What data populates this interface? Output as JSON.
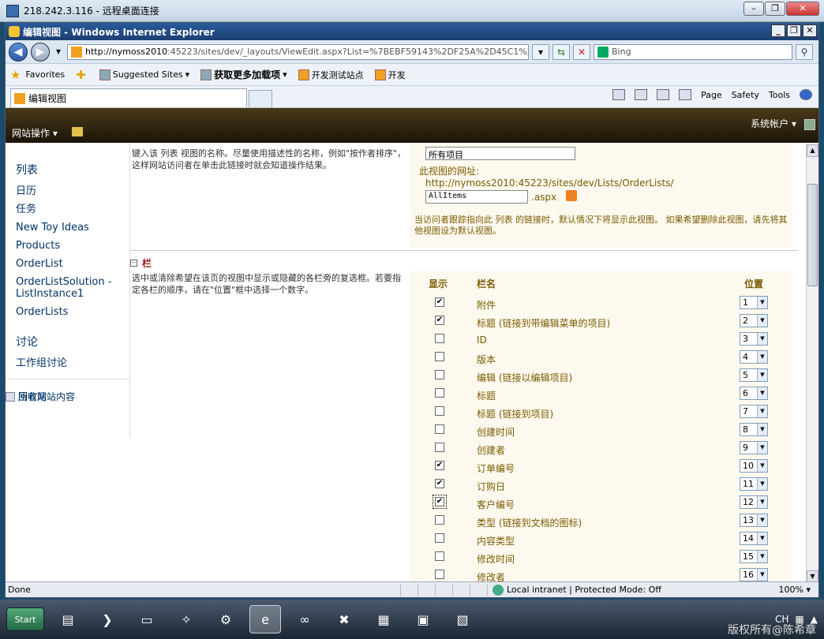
{
  "rdp": {
    "title": "218.242.3.116 - 远程桌面连接"
  },
  "browser": {
    "title": "编辑视图 - Windows Internet Explorer",
    "address": "http://nymoss2010:45223/sites/dev/_layouts/ViewEdit.aspx?List=%7BEBF59143%2DF25A%2D45C1%2DBEBD%",
    "address_host": "http://nymoss2010",
    "address_rest": ":45223/sites/dev/_layouts/ViewEdit.aspx?List=%7BEBF59143%2DF25A%2D45C1%2DBEBD%",
    "search_placeholder": "Bing",
    "favorites": {
      "label": "Favorites",
      "suggested": "Suggested Sites",
      "more_addons": "获取更多加载项",
      "dev_test": "开发测试站点",
      "dev": "开发"
    },
    "tab_label": "编辑视图",
    "commands": {
      "page": "Page",
      "safety": "Safety",
      "tools": "Tools"
    },
    "status": {
      "done": "Done",
      "zone": "Local intranet | Protected Mode: Off",
      "zoom": "100%"
    }
  },
  "sharepoint": {
    "site_actions": "网站操作",
    "account": "系统帐户",
    "leftnav": {
      "lists_head": "列表",
      "lists": [
        "日历",
        "任务",
        "New Toy Ideas",
        "Products",
        "OrderList",
        "OrderListSolution - ListInstance1",
        "OrderLists"
      ],
      "discussions_head": "讨论",
      "discussions": [
        "工作组讨论"
      ],
      "recycle": "回收站",
      "all_content": "所有网站内容"
    },
    "name_section": {
      "desc": "键入该 列表 视图的名称。尽量使用描述性的名称，例如\"按作者排序\"，这样网站访问者在单击此链接时就会知道操作结果。",
      "view_name_value": "所有项目",
      "url_label": "此视图的网址:",
      "url": "http://nymoss2010:45223/sites/dev/Lists/OrderLists/",
      "file_value": "AllItems",
      "ext": ".aspx",
      "note": "当访问者跟踪指向此 列表 的链接时，默认情况下将显示此视图。 如果希望删除此视图，请先将其他视图设为默认视图。"
    },
    "columns_section": {
      "title": "栏",
      "desc": "选中或清除希望在该页的视图中显示或隐藏的各栏旁的复选框。若要指定各栏的顺序，请在\"位置\"框中选择一个数字。",
      "hdr_show": "显示",
      "hdr_name": "栏名",
      "hdr_pos": "位置",
      "rows": [
        {
          "checked": true,
          "name": "附件",
          "pos": "1"
        },
        {
          "checked": true,
          "name": "标题 (链接到带编辑菜单的项目)",
          "pos": "2"
        },
        {
          "checked": false,
          "name": "ID",
          "pos": "3"
        },
        {
          "checked": false,
          "name": "版本",
          "pos": "4"
        },
        {
          "checked": false,
          "name": "编辑 (链接以编辑项目)",
          "pos": "5"
        },
        {
          "checked": false,
          "name": "标题",
          "pos": "6"
        },
        {
          "checked": false,
          "name": "标题 (链接到项目)",
          "pos": "7"
        },
        {
          "checked": false,
          "name": "创建时间",
          "pos": "8"
        },
        {
          "checked": false,
          "name": "创建者",
          "pos": "9"
        },
        {
          "checked": true,
          "name": "订单编号",
          "pos": "10"
        },
        {
          "checked": true,
          "name": "订购日",
          "pos": "11"
        },
        {
          "checked": true,
          "name": "客户编号",
          "pos": "12",
          "focused": true
        },
        {
          "checked": false,
          "name": "类型 (链接到文档的图标)",
          "pos": "13"
        },
        {
          "checked": false,
          "name": "内容类型",
          "pos": "14"
        },
        {
          "checked": false,
          "name": "修改时间",
          "pos": "15"
        },
        {
          "checked": false,
          "name": "修改者",
          "pos": "16"
        }
      ]
    }
  },
  "taskbar": {
    "start": "Start",
    "lang": "CH",
    "watermark": "版权所有@陈希章"
  }
}
